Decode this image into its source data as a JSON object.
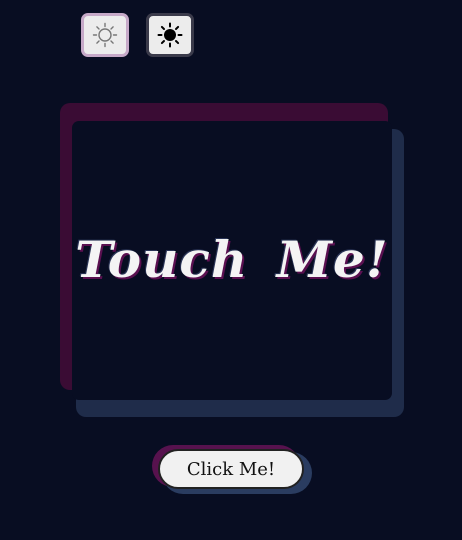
{
  "theme_buttons": {
    "light_icon": "sun-outline-icon",
    "dark_icon": "sun-filled-icon"
  },
  "card": {
    "title": "Touch Me!"
  },
  "action_button": {
    "label": "Click Me!"
  },
  "colors": {
    "background": "#080d22",
    "accent_pink": "#3a0c34",
    "accent_blue": "#1f2c4a",
    "card_text": "#f4f4f4",
    "button_bg": "#f1f1f1"
  }
}
